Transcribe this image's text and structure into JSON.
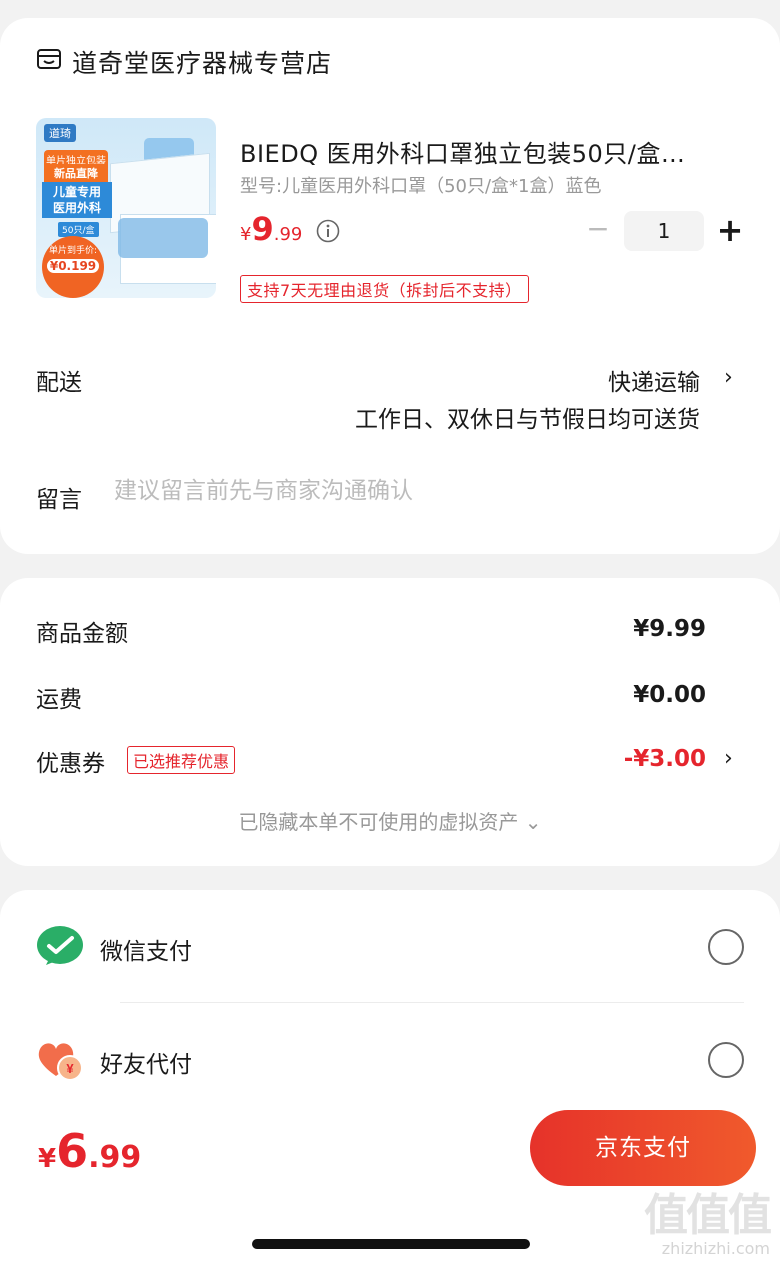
{
  "store": {
    "name": "道奇堂医疗器械专营店",
    "icon": "store-icon"
  },
  "product": {
    "title": "BIEDQ 医用外科口罩独立包装50只/盒…",
    "spec": "型号:儿童医用外科口罩（50只/盒*1盒）蓝色",
    "price_currency": "¥",
    "price_int": "9",
    "price_dec": ".99",
    "quantity": "1",
    "minus_label": "−",
    "plus_label": "+",
    "return_policy": "支持7天无理由退货（拆封后不支持）",
    "thumbnail": {
      "brand": "道琦",
      "tag_line1": "单片独立包装",
      "tag_line2": "新品直降",
      "tag_main": "儿童专用\n医用外科",
      "tag_count": "50只/盒",
      "badge_line": "单片到手价:",
      "badge_price": "¥0.199"
    }
  },
  "delivery": {
    "label": "配送",
    "method": "快递运输",
    "note": "工作日、双休日与节假日均可送货",
    "arrow": "›"
  },
  "message": {
    "label": "留言",
    "placeholder": "建议留言前先与商家沟通确认"
  },
  "summary": {
    "goods_label": "商品金额",
    "goods_value": "¥9.99",
    "shipping_label": "运费",
    "shipping_value": "¥0.00",
    "coupon_label": "优惠券",
    "coupon_tag": "已选推荐优惠",
    "coupon_value": "-¥3.00",
    "hidden_assets": "已隐藏本单不可使用的虚拟资产 ⌄"
  },
  "payment_methods": [
    {
      "label": "微信支付",
      "icon": "wechat-pay-icon"
    },
    {
      "label": "好友代付",
      "icon": "friend-pay-icon"
    }
  ],
  "footer": {
    "total_currency": "¥",
    "total_int": "6",
    "total_dec": ".99",
    "pay_button": "京东支付"
  },
  "watermark": {
    "logo": "值值值",
    "url": "zhizhizhi.com"
  },
  "colors": {
    "accent_red": "#e5252d",
    "button_gradient_start": "#e6322a",
    "button_gradient_end": "#f05a2c",
    "wechat_green": "#2aae67"
  }
}
